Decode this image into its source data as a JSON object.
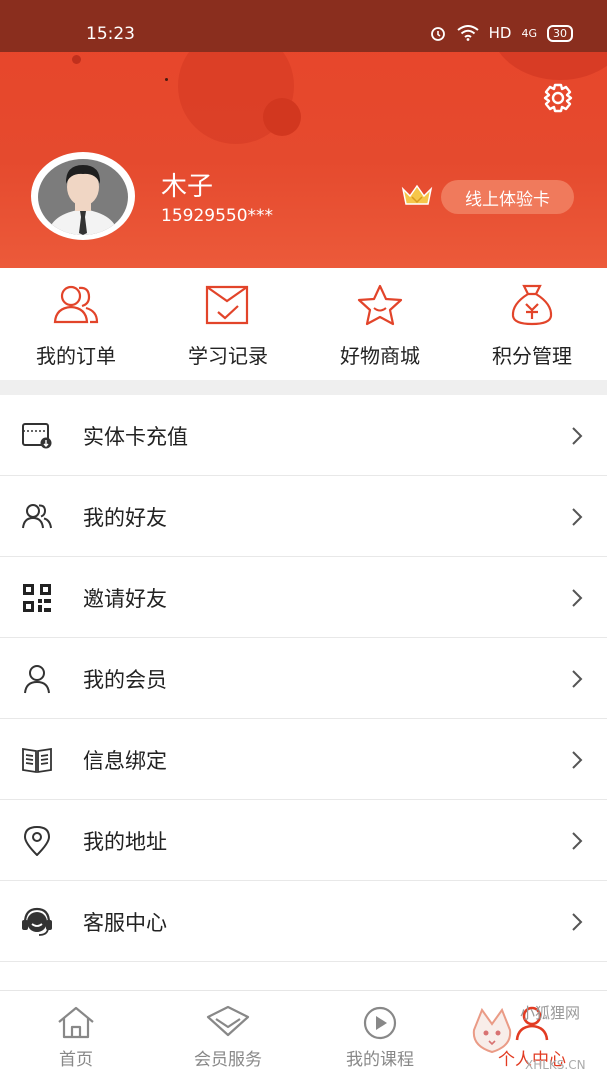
{
  "status_bar": {
    "time": "15:23",
    "network": "HD",
    "signal": "4G",
    "battery": "30"
  },
  "profile": {
    "name": "木子",
    "phone": "15929550***",
    "vip_label": "线上体验卡"
  },
  "quick_actions": [
    {
      "label": "我的订单",
      "icon": "users-icon"
    },
    {
      "label": "学习记录",
      "icon": "study-record-icon"
    },
    {
      "label": "好物商城",
      "icon": "star-icon"
    },
    {
      "label": "积分管理",
      "icon": "money-bag-icon"
    }
  ],
  "menu": [
    {
      "label": "实体卡充值",
      "icon": "card-recharge-icon"
    },
    {
      "label": "我的好友",
      "icon": "friends-icon"
    },
    {
      "label": "邀请好友",
      "icon": "qr-code-icon"
    },
    {
      "label": "我的会员",
      "icon": "person-icon"
    },
    {
      "label": "信息绑定",
      "icon": "book-icon"
    },
    {
      "label": "我的地址",
      "icon": "location-pin-icon"
    },
    {
      "label": "客服中心",
      "icon": "headset-icon"
    }
  ],
  "tabs": [
    {
      "label": "首页",
      "icon": "home-icon",
      "active": false
    },
    {
      "label": "会员服务",
      "icon": "diamond-icon",
      "active": false
    },
    {
      "label": "我的课程",
      "icon": "play-icon",
      "active": false
    },
    {
      "label": "个人中心",
      "icon": "person-icon",
      "active": true
    }
  ],
  "watermark": {
    "text": "小狐狸网",
    "sub": "XHLKS.CN"
  },
  "colors": {
    "brand_red": "#e54a2e",
    "active_tab": "#e23b22",
    "icon_red": "#e2442a"
  }
}
